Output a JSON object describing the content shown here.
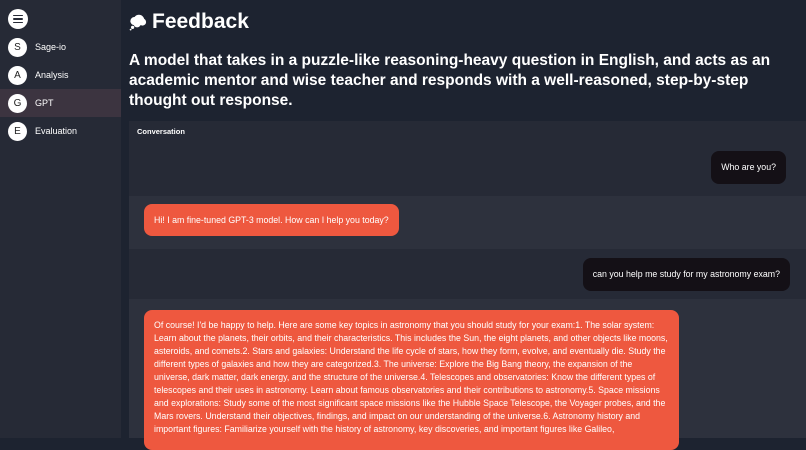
{
  "sidebar": {
    "items": [
      {
        "avatar": "S",
        "label": "Sage-io"
      },
      {
        "avatar": "A",
        "label": "Analysis"
      },
      {
        "avatar": "G",
        "label": "GPT"
      },
      {
        "avatar": "E",
        "label": "Evaluation"
      }
    ],
    "active_item": "GPT",
    "icons": {
      "menu": "hamburger-menu-icon"
    }
  },
  "header": {
    "title": "Feedback",
    "title_icon": "thought-bubble-icon",
    "subtitle": "A model that takes in a puzzle-like reasoning-heavy question in English, and acts as an academic mentor and wise teacher and responds with a well-reasoned, step-by-step thought out response."
  },
  "conversation": {
    "label": "Conversation",
    "messages": [
      {
        "role": "user",
        "text": "Who are you?"
      },
      {
        "role": "assistant",
        "text": "Hi! I am fine-tuned GPT-3 model. How can I help you today?"
      },
      {
        "role": "user",
        "text": "can you help me study for my astronomy exam?"
      },
      {
        "role": "assistant",
        "text": "Of course! I'd be happy to help. Here are some key topics in astronomy that you should study for your exam:1. The solar system: Learn about the planets, their orbits, and their characteristics. This includes the Sun, the eight planets, and other objects like moons, asteroids, and comets.2. Stars and galaxies: Understand the life cycle of stars, how they form, evolve, and eventually die. Study the different types of galaxies and how they are categorized.3. The universe: Explore the Big Bang theory, the expansion of the universe, dark matter, dark energy, and the structure of the universe.4. Telescopes and observatories: Know the different types of telescopes and their uses in astronomy. Learn about famous observatories and their contributions to astronomy.5. Space missions and explorations: Study some of the most significant space missions like the Hubble Space Telescope, the Voyager probes, and the Mars rovers. Understand their objectives, findings, and impact on our understanding of the universe.6. Astronomy history and important figures: Familiarize yourself with the history of astronomy, key discoveries, and important figures like Galileo,"
      }
    ]
  },
  "colors": {
    "background": "#1d2330",
    "sidebar": "#262a36",
    "active_nav": "#3c3440",
    "user_bubble": "#141016",
    "assistant_bubble": "#ee583f"
  }
}
